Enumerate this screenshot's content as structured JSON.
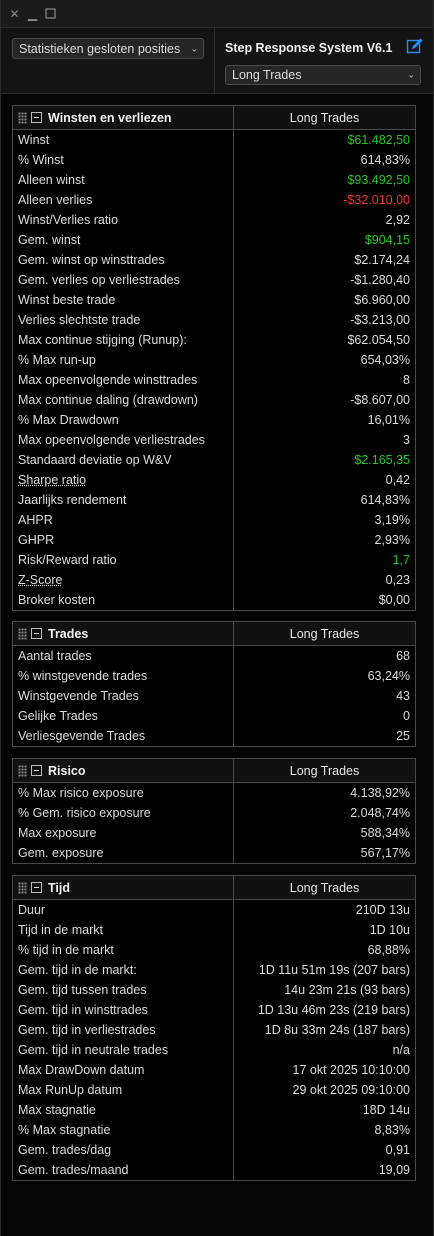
{
  "toolbar": {
    "view_select": "Statistieken gesloten posities",
    "strategy_name": "Step Response System V6.1",
    "trade_filter": "Long Trades"
  },
  "colors": {
    "positive": "#26c826",
    "negative": "#ee3434",
    "accent": "#1e90ff"
  },
  "sections": [
    {
      "title": "Winsten en verliezen",
      "column": "Long Trades",
      "rows": [
        {
          "label": "Winst",
          "value": "$61.482,50",
          "tone": "pos"
        },
        {
          "label": "% Winst",
          "value": "614,83%"
        },
        {
          "label": "Alleen winst",
          "value": "$93.492,50",
          "tone": "pos"
        },
        {
          "label": "Alleen verlies",
          "value": "-$32.010,00",
          "tone": "neg"
        },
        {
          "label": "Winst/Verlies ratio",
          "value": "2,92"
        },
        {
          "label": "Gem. winst",
          "value": "$904,15",
          "tone": "pos"
        },
        {
          "label": "Gem. winst op winsttrades",
          "value": "$2.174,24"
        },
        {
          "label": "Gem. verlies op verliestrades",
          "value": "-$1.280,40"
        },
        {
          "label": "Winst beste trade",
          "value": "$6.960,00"
        },
        {
          "label": "Verlies slechtste trade",
          "value": "-$3.213,00"
        },
        {
          "label": "Max continue stijging (Runup):",
          "value": "$62.054,50"
        },
        {
          "label": "% Max run-up",
          "value": "654,03%"
        },
        {
          "label": "Max opeenvolgende winsttrades",
          "value": "8"
        },
        {
          "label": "Max continue daling (drawdown)",
          "value": "-$8.607,00"
        },
        {
          "label": "% Max Drawdown",
          "value": "16,01%"
        },
        {
          "label": "Max opeenvolgende verliestrades",
          "value": "3"
        },
        {
          "label": "Standaard deviatie op W&V",
          "value": "$2.165,35",
          "tone": "pos"
        },
        {
          "label": "Sharpe ratio",
          "value": "0,42",
          "link": true
        },
        {
          "label": "Jaarlijks rendement",
          "value": "614,83%"
        },
        {
          "label": "AHPR",
          "value": "3,19%"
        },
        {
          "label": "GHPR",
          "value": "2,93%"
        },
        {
          "label": "Risk/Reward ratio",
          "value": "1,7",
          "tone": "pos"
        },
        {
          "label": "Z-Score",
          "value": "0,23",
          "link": true
        },
        {
          "label": "Broker kosten",
          "value": "$0,00"
        }
      ]
    },
    {
      "title": "Trades",
      "column": "Long Trades",
      "rows": [
        {
          "label": "Aantal trades",
          "value": "68"
        },
        {
          "label": "% winstgevende trades",
          "value": "63,24%"
        },
        {
          "label": "Winstgevende Trades",
          "value": "43"
        },
        {
          "label": "Gelijke Trades",
          "value": "0"
        },
        {
          "label": "Verliesgevende Trades",
          "value": "25"
        }
      ]
    },
    {
      "title": "Risico",
      "column": "Long Trades",
      "rows": [
        {
          "label": "% Max risico exposure",
          "value": "4.138,92%"
        },
        {
          "label": "% Gem. risico exposure",
          "value": "2.048,74%"
        },
        {
          "label": "Max exposure",
          "value": "588,34%"
        },
        {
          "label": "Gem. exposure",
          "value": "567,17%"
        }
      ]
    },
    {
      "title": "Tijd",
      "column": "Long Trades",
      "rows": [
        {
          "label": "Duur",
          "value": "210D 13u"
        },
        {
          "label": "Tijd in de markt",
          "value": "1D 10u"
        },
        {
          "label": "% tijd in de markt",
          "value": "68,88%"
        },
        {
          "label": "Gem. tijd in de markt:",
          "value": "1D 11u 51m 19s (207 bars)"
        },
        {
          "label": "Gem. tijd tussen trades",
          "value": "14u 23m 21s (93 bars)"
        },
        {
          "label": "Gem. tijd in winsttrades",
          "value": "1D 13u 46m 23s (219 bars)"
        },
        {
          "label": "Gem. tijd in verliestrades",
          "value": "1D 8u 33m 24s (187 bars)"
        },
        {
          "label": "Gem. tijd in neutrale trades",
          "value": "n/a"
        },
        {
          "label": "Max DrawDown datum",
          "value": "17 okt 2025 10:10:00"
        },
        {
          "label": "Max RunUp datum",
          "value": "29 okt 2025 09:10:00"
        },
        {
          "label": "Max stagnatie",
          "value": "18D 14u"
        },
        {
          "label": "% Max stagnatie",
          "value": "8,83%"
        },
        {
          "label": "Gem. trades/dag",
          "value": "0,91"
        },
        {
          "label": "Gem. trades/maand",
          "value": "19,09"
        }
      ]
    }
  ]
}
